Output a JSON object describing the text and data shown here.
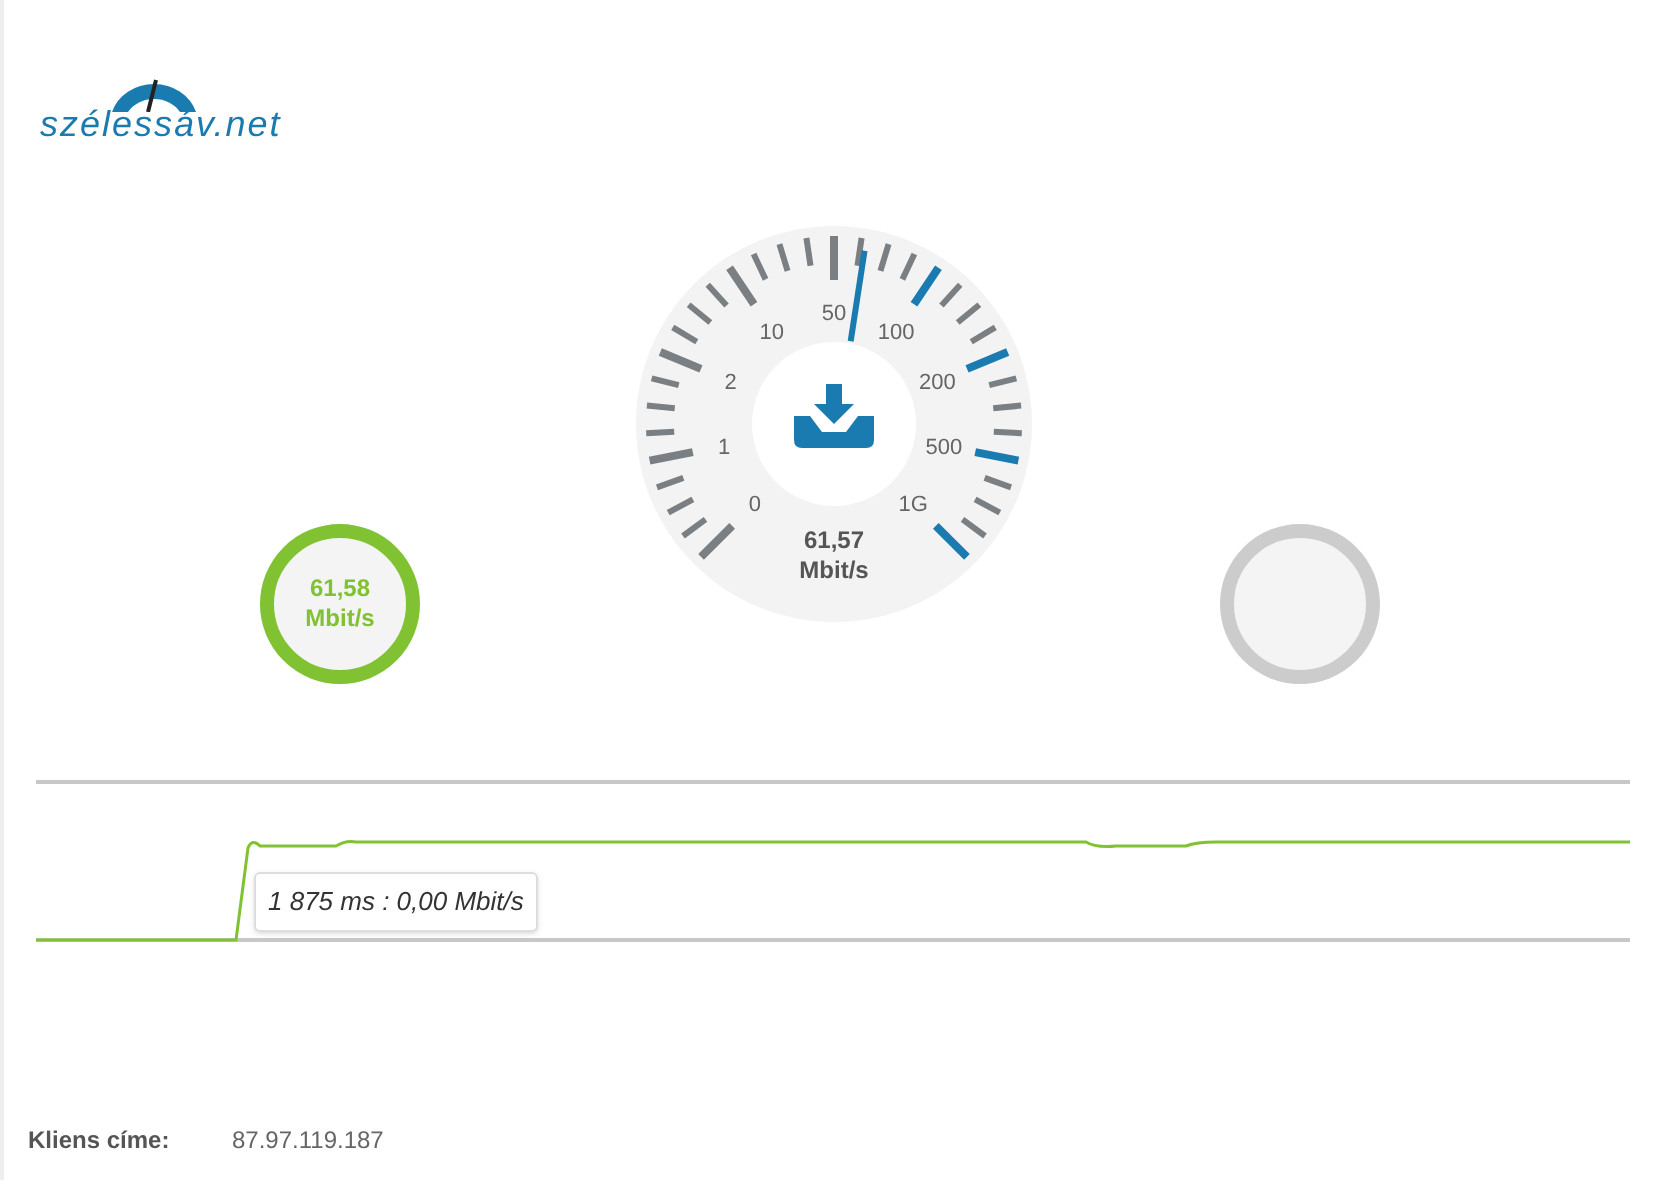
{
  "logo": {
    "text": "szélessáv.net"
  },
  "gauge": {
    "scale_labels": [
      "0",
      "1",
      "2",
      "10",
      "50",
      "100",
      "200",
      "500",
      "1G"
    ],
    "value": "61,57",
    "unit": "Mbit/s"
  },
  "result_circles": [
    {
      "value": "61,58",
      "unit": "Mbit/s",
      "done": true
    },
    {
      "done": false
    }
  ],
  "graph": {
    "tooltip": "1 875 ms : 0,00 Mbit/s"
  },
  "client": {
    "label": "Kliens címe:",
    "value": "87.97.119.187"
  }
}
